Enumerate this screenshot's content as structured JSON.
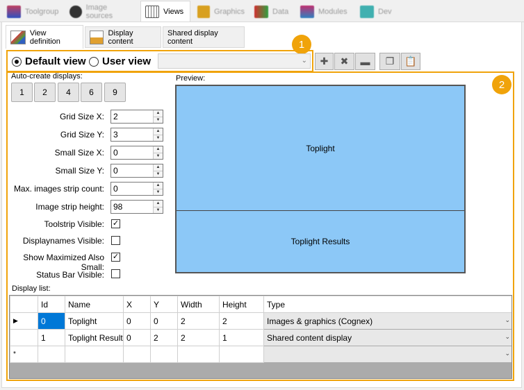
{
  "top_tabs": [
    {
      "label": "Toolgroup",
      "icon": "toolgroup-icon",
      "color": "#c04060"
    },
    {
      "label": "Image sources",
      "icon": "camera-icon",
      "color": "#333333"
    },
    {
      "label": "Views",
      "icon": "views-icon",
      "color": "#555555"
    },
    {
      "label": "Graphics",
      "icon": "graphics-icon",
      "color": "#d8a020"
    },
    {
      "label": "Data",
      "icon": "data-icon",
      "color": "#d03030"
    },
    {
      "label": "Modules",
      "icon": "modules-icon",
      "color": "#c03070"
    },
    {
      "label": "Dev",
      "icon": "dev-icon",
      "color": "#40b0b0"
    }
  ],
  "sub_tabs": [
    {
      "label": "View definition",
      "icon": "view-definition-icon"
    },
    {
      "label": "Display content",
      "icon": "display-content-icon"
    },
    {
      "label": "Shared display content"
    }
  ],
  "view_select": {
    "default_label": "Default view",
    "user_label": "User view",
    "selected": "default",
    "combo_value": ""
  },
  "badges": {
    "one": "1",
    "two": "2"
  },
  "auto_create": {
    "label": "Auto-create displays:",
    "buttons": [
      "1",
      "2",
      "4",
      "6",
      "9"
    ]
  },
  "settings": {
    "grid_x": {
      "label": "Grid Size X:",
      "value": "2"
    },
    "grid_y": {
      "label": "Grid Size Y:",
      "value": "3"
    },
    "small_x": {
      "label": "Small Size X:",
      "value": "0"
    },
    "small_y": {
      "label": "Small Size Y:",
      "value": "0"
    },
    "max_strip": {
      "label": "Max. images strip count:",
      "value": "0"
    },
    "strip_height": {
      "label": "Image strip height:",
      "value": "98"
    },
    "toolstrip": {
      "label": "Toolstrip Visible:",
      "checked": true
    },
    "displaynames": {
      "label": "Displaynames Visible:",
      "checked": false
    },
    "show_max": {
      "label": "Show Maximized Also Small:",
      "checked": true
    },
    "status_bar": {
      "label": "Status Bar Visible:",
      "checked": false
    }
  },
  "preview": {
    "label": "Preview:",
    "top": "Toplight",
    "bottom": "Toplight Results"
  },
  "display_list": {
    "label": "Display list:",
    "columns": [
      "Id",
      "Name",
      "X",
      "Y",
      "Width",
      "Height",
      "Type"
    ],
    "rows": [
      {
        "id": "0",
        "name": "Toplight",
        "x": "0",
        "y": "0",
        "width": "2",
        "height": "2",
        "type": "Images & graphics (Cognex)"
      },
      {
        "id": "1",
        "name": "Toplight Results",
        "x": "0",
        "y": "2",
        "width": "2",
        "height": "1",
        "type": "Shared content display"
      }
    ],
    "new_row_marker": "*",
    "current_row_marker": "▶"
  },
  "colors": {
    "accent": "#f0a30a",
    "preview": "#8cc8f7",
    "selection": "#0078d7"
  }
}
